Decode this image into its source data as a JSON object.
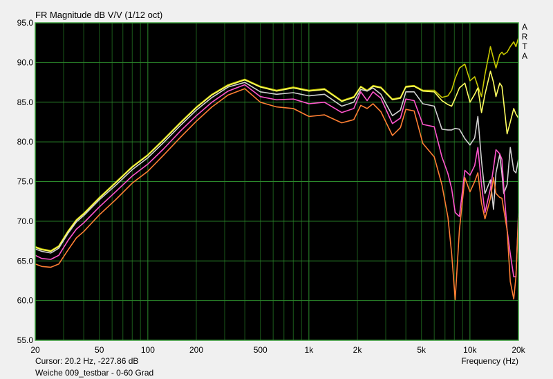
{
  "chart_data": {
    "type": "line",
    "title": "FR Magnitude dB V/V (1/12 oct)",
    "xlabel": "Frequency (Hz)",
    "ylabel": "",
    "xscale": "log",
    "xlim": [
      20,
      20000
    ],
    "ylim": [
      55,
      95
    ],
    "grid": true,
    "yticks": [
      "95.0",
      "90.0",
      "85.0",
      "80.0",
      "75.0",
      "70.0",
      "65.0",
      "60.0",
      "55.0"
    ],
    "ytick_values": [
      95,
      90,
      85,
      80,
      75,
      70,
      65,
      60,
      55
    ],
    "xticks": [
      "20",
      "50",
      "100",
      "200",
      "500",
      "1k",
      "2k",
      "5k",
      "10k",
      "20k"
    ],
    "xtick_values": [
      20,
      50,
      100,
      200,
      500,
      1000,
      2000,
      5000,
      10000,
      20000
    ],
    "x": [
      20,
      22,
      25,
      28,
      32,
      36,
      40,
      50,
      63,
      80,
      100,
      125,
      160,
      200,
      250,
      315,
      400,
      500,
      630,
      800,
      1000,
      1250,
      1600,
      1900,
      2100,
      2300,
      2500,
      2800,
      3300,
      3700,
      4000,
      4500,
      5100,
      6000,
      6700,
      7300,
      7700,
      8100,
      8600,
      9300,
      10000,
      10700,
      11200,
      11800,
      12400,
      13400,
      14000,
      14500,
      15300,
      15800,
      16200,
      17000,
      17800,
      18700,
      19300,
      20000
    ],
    "series": [
      {
        "name": "curve-1",
        "color": "#c8c800",
        "values": [
          66.8,
          66.5,
          66.3,
          66.9,
          68.8,
          70.2,
          71.0,
          73.0,
          74.9,
          76.9,
          78.4,
          80.3,
          82.5,
          84.4,
          86.0,
          87.2,
          87.9,
          87.0,
          86.5,
          86.9,
          86.5,
          86.7,
          85.2,
          85.7,
          87.0,
          86.5,
          87.1,
          86.9,
          85.4,
          85.6,
          87.0,
          87.1,
          86.5,
          86.5,
          85.6,
          85.8,
          86.5,
          88.0,
          89.3,
          89.8,
          87.7,
          88.2,
          87.0,
          85.7,
          88.5,
          92.0,
          90.5,
          89.3,
          91.0,
          91.3,
          91.0,
          91.3,
          92.0,
          92.6,
          92.0,
          93.1
        ]
      },
      {
        "name": "curve-2",
        "color": "#ffff60",
        "values": [
          66.7,
          66.4,
          66.2,
          66.8,
          68.7,
          70.1,
          70.9,
          72.9,
          74.8,
          76.8,
          78.3,
          80.2,
          82.4,
          84.3,
          85.9,
          87.1,
          87.8,
          86.9,
          86.4,
          86.8,
          86.4,
          86.6,
          85.1,
          85.6,
          86.9,
          86.4,
          87.0,
          86.8,
          85.3,
          85.5,
          86.9,
          87.0,
          86.4,
          86.3,
          85.2,
          84.7,
          84.5,
          85.5,
          86.8,
          87.4,
          85.0,
          86.0,
          86.8,
          83.7,
          86.0,
          88.9,
          87.5,
          85.7,
          87.4,
          87.0,
          85.0,
          81.0,
          82.5,
          84.2,
          83.5,
          83.0
        ]
      },
      {
        "name": "curve-3",
        "color": "#d0d0d0",
        "values": [
          66.5,
          66.2,
          66.0,
          66.6,
          68.5,
          69.9,
          70.7,
          72.7,
          74.5,
          76.5,
          78.0,
          79.9,
          82.1,
          84.0,
          85.6,
          86.9,
          87.5,
          86.3,
          86.0,
          86.2,
          85.8,
          86.0,
          84.5,
          85.0,
          86.6,
          86.4,
          86.8,
          86.0,
          83.3,
          84.0,
          86.3,
          86.3,
          84.8,
          84.5,
          81.6,
          81.5,
          81.5,
          81.7,
          81.6,
          80.4,
          79.6,
          80.5,
          83.2,
          77.6,
          73.5,
          75.2,
          71.5,
          76.1,
          78.4,
          76.0,
          73.5,
          74.6,
          79.3,
          76.4,
          76.1,
          77.8
        ]
      },
      {
        "name": "curve-4",
        "color": "#ff55cc",
        "values": [
          65.7,
          65.3,
          65.2,
          65.7,
          67.6,
          69.0,
          69.8,
          71.8,
          73.7,
          75.7,
          77.2,
          79.1,
          81.4,
          83.3,
          85.0,
          86.4,
          87.2,
          85.7,
          85.3,
          85.4,
          84.8,
          85.0,
          83.7,
          84.2,
          86.3,
          85.2,
          86.3,
          85.5,
          82.3,
          83.0,
          85.4,
          85.2,
          82.2,
          81.9,
          78.1,
          76.0,
          74.1,
          71.1,
          70.6,
          76.4,
          75.8,
          77.0,
          79.3,
          74.6,
          71.1,
          74.1,
          76.7,
          79.0,
          78.5,
          77.8,
          74.4,
          68.9,
          65.9,
          63.0,
          63.0,
          71.0
        ]
      },
      {
        "name": "curve-5",
        "color": "#ff7f33",
        "values": [
          64.6,
          64.3,
          64.2,
          64.6,
          66.4,
          67.9,
          68.7,
          70.8,
          72.7,
          74.8,
          76.3,
          78.3,
          80.6,
          82.6,
          84.4,
          85.9,
          86.7,
          85.0,
          84.4,
          84.2,
          83.2,
          83.4,
          82.4,
          82.8,
          84.6,
          84.2,
          84.8,
          83.8,
          80.8,
          81.8,
          84.1,
          83.9,
          79.8,
          78.1,
          74.6,
          70.5,
          65.9,
          60.1,
          68.9,
          75.5,
          73.7,
          75.0,
          76.1,
          72.3,
          70.3,
          72.9,
          75.5,
          73.5,
          73.0,
          72.9,
          71.5,
          68.9,
          62.4,
          60.2,
          63.0,
          70.5
        ]
      }
    ],
    "colors": {
      "grid": "#1b5a1b",
      "grid_decade": "#2c8a2c",
      "frame": "#3aa03a",
      "plot_bg": "#000000"
    }
  },
  "brand": [
    "A",
    "R",
    "T",
    "A"
  ],
  "status": {
    "cursor": "Cursor: 20.2 Hz, -227.86 dB",
    "footer": "Weiche 009_testbar - 0-60 Grad"
  }
}
